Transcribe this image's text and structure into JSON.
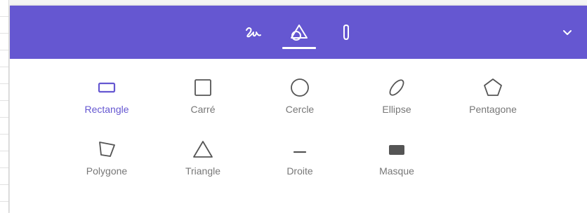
{
  "colors": {
    "accent": "#6557d1",
    "icon": "#555555",
    "label": "#777777"
  },
  "header": {
    "tabs": [
      {
        "icon": "signature-icon",
        "active": false
      },
      {
        "icon": "shapes-icon",
        "active": true
      },
      {
        "icon": "paperclip-icon",
        "active": false
      }
    ],
    "collapse_icon": "chevron-down-icon"
  },
  "shapes": {
    "row1": [
      {
        "label": "Rectangle",
        "icon": "rectangle-icon",
        "selected": true
      },
      {
        "label": "Carré",
        "icon": "square-icon",
        "selected": false
      },
      {
        "label": "Cercle",
        "icon": "circle-icon",
        "selected": false
      },
      {
        "label": "Ellipse",
        "icon": "ellipse-icon",
        "selected": false
      },
      {
        "label": "Pentagone",
        "icon": "pentagon-icon",
        "selected": false
      }
    ],
    "row2": [
      {
        "label": "Polygone",
        "icon": "polygon-icon",
        "selected": false
      },
      {
        "label": "Triangle",
        "icon": "triangle-icon",
        "selected": false
      },
      {
        "label": "Droite",
        "icon": "line-icon",
        "selected": false
      },
      {
        "label": "Masque",
        "icon": "mask-icon",
        "selected": false
      }
    ]
  }
}
